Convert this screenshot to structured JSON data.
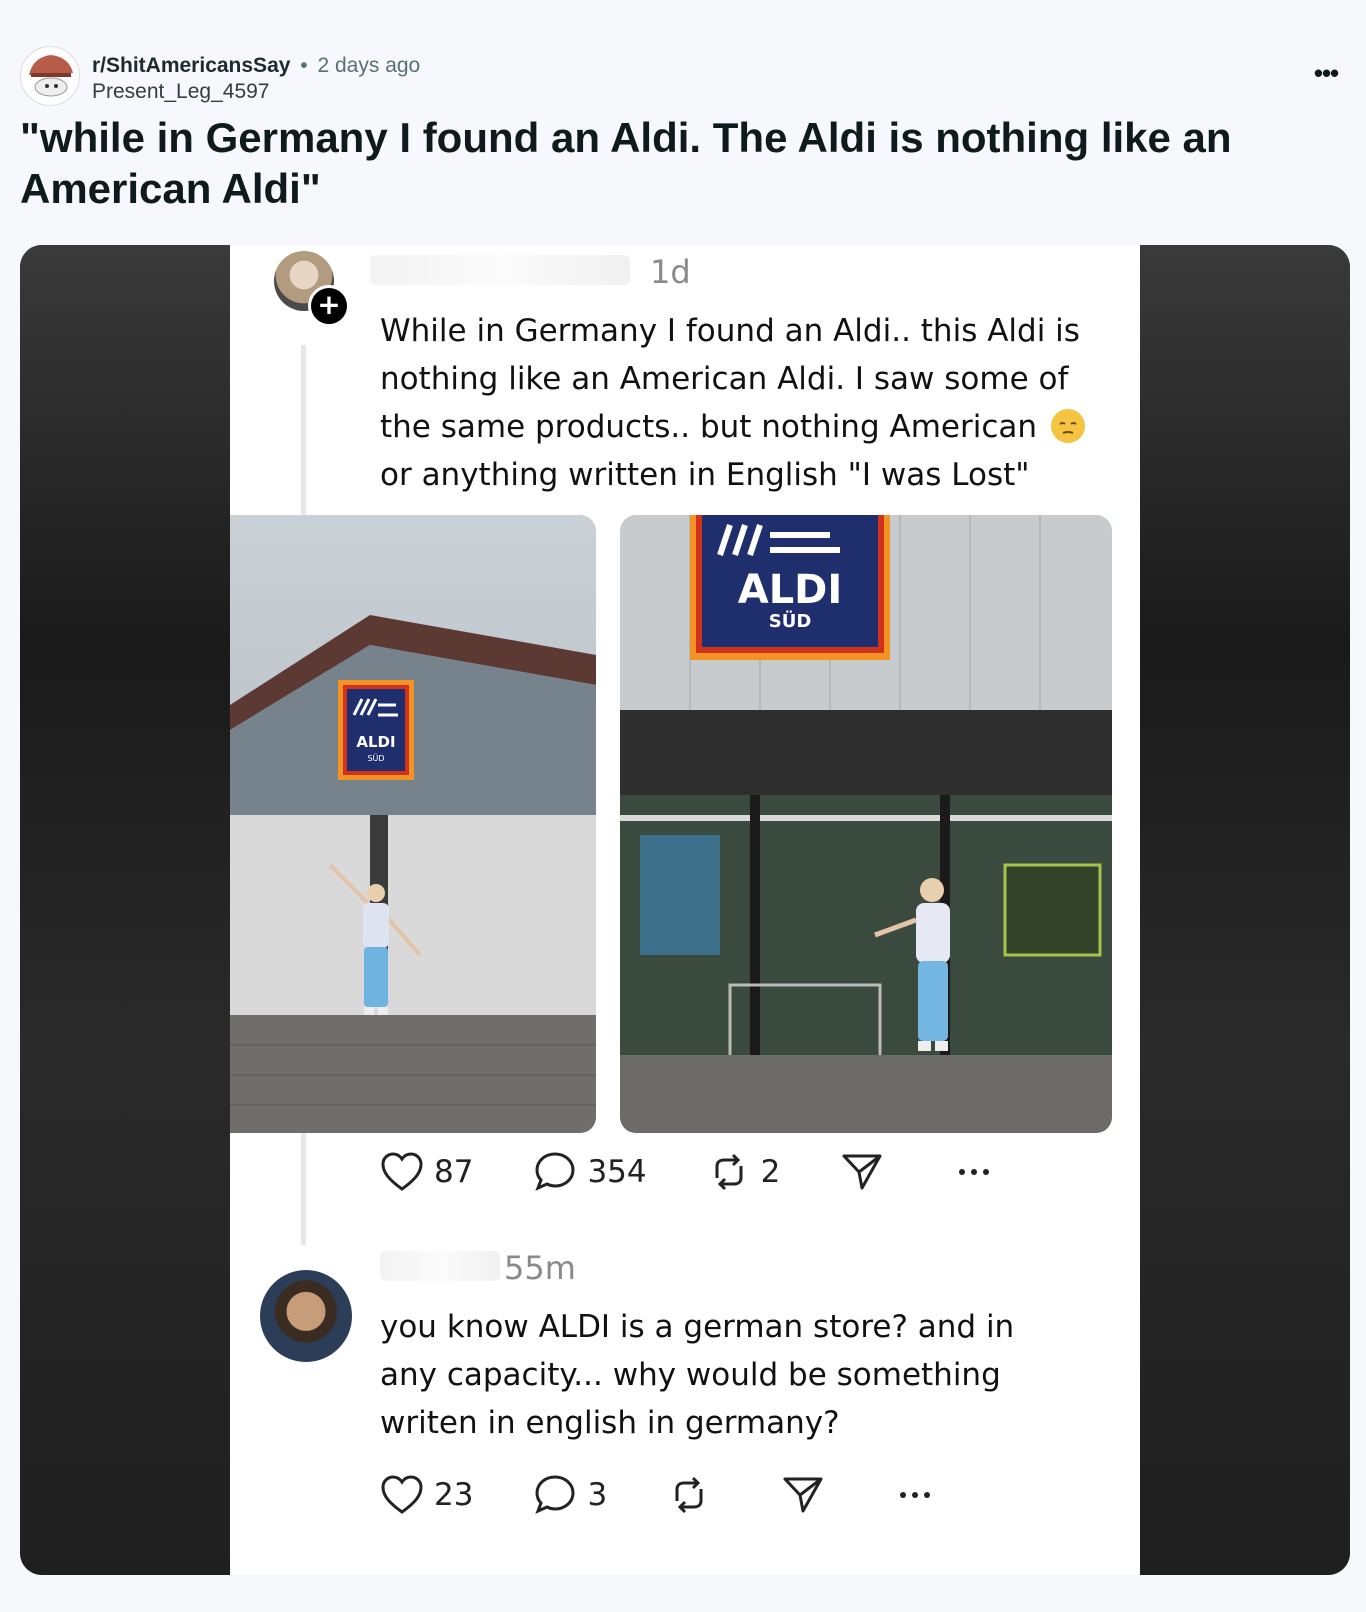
{
  "post": {
    "subreddit": "r/ShitAmericansSay",
    "separator": "•",
    "time_ago": "2 days ago",
    "author": "Present_Leg_4597",
    "more_label": "•••",
    "title": "\"while in Germany I found an Aldi. The Aldi is nothing like an American Aldi\""
  },
  "screenshot": {
    "first": {
      "time": "1d",
      "plus": "+",
      "text_before_emoji": "While in Germany I found an Aldi.. this Aldi is nothing like an American Aldi. I saw some of the same products.. but nothing American",
      "text_after_emoji": "or anything written in English \"I was Lost\"",
      "likes": "87",
      "replies": "354",
      "reposts": "2"
    },
    "second": {
      "time": "55m",
      "text": "you know ALDI is a german store? and in any capacity... why would be something writen in english in germany?",
      "likes": "23",
      "replies": "3"
    },
    "sign_text": "ALDI",
    "sign_sub": "SÜD"
  },
  "colors": {
    "background": "#f6f8fb",
    "text": "#0f1a1c",
    "meta": "#576f76",
    "aldi_blue": "#1f2f6e",
    "aldi_orange": "#f39323",
    "aldi_red": "#d0321e"
  }
}
